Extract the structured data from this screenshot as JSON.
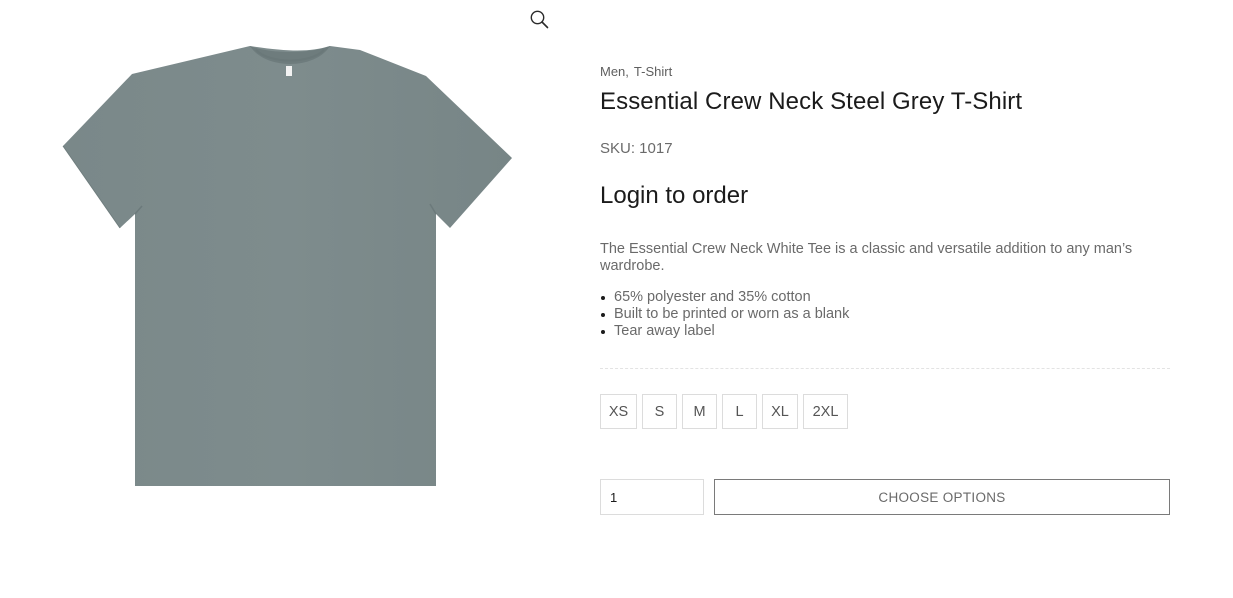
{
  "gallery": {
    "zoom_icon": "magnifier-icon",
    "image_alt": "Essential Crew Neck Steel Grey T-Shirt",
    "shirt_color": "#7b8a8b"
  },
  "product": {
    "categories": [
      "Men",
      "T-Shirt"
    ],
    "title": "Essential Crew Neck Steel Grey T-Shirt",
    "sku": "SKU: 1017",
    "login_text": "Login to order",
    "description": "The Essential Crew Neck White Tee is a classic and versatile addition to any man’s wardrobe.",
    "features": [
      "65% polyester and 35% cotton",
      "Built to be printed or worn as a blank",
      "Tear away label"
    ]
  },
  "sizes": [
    "XS",
    "S",
    "M",
    "L",
    "XL",
    "2XL"
  ],
  "cart": {
    "quantity": "1",
    "choose_options_label": "CHOOSE OPTIONS"
  }
}
